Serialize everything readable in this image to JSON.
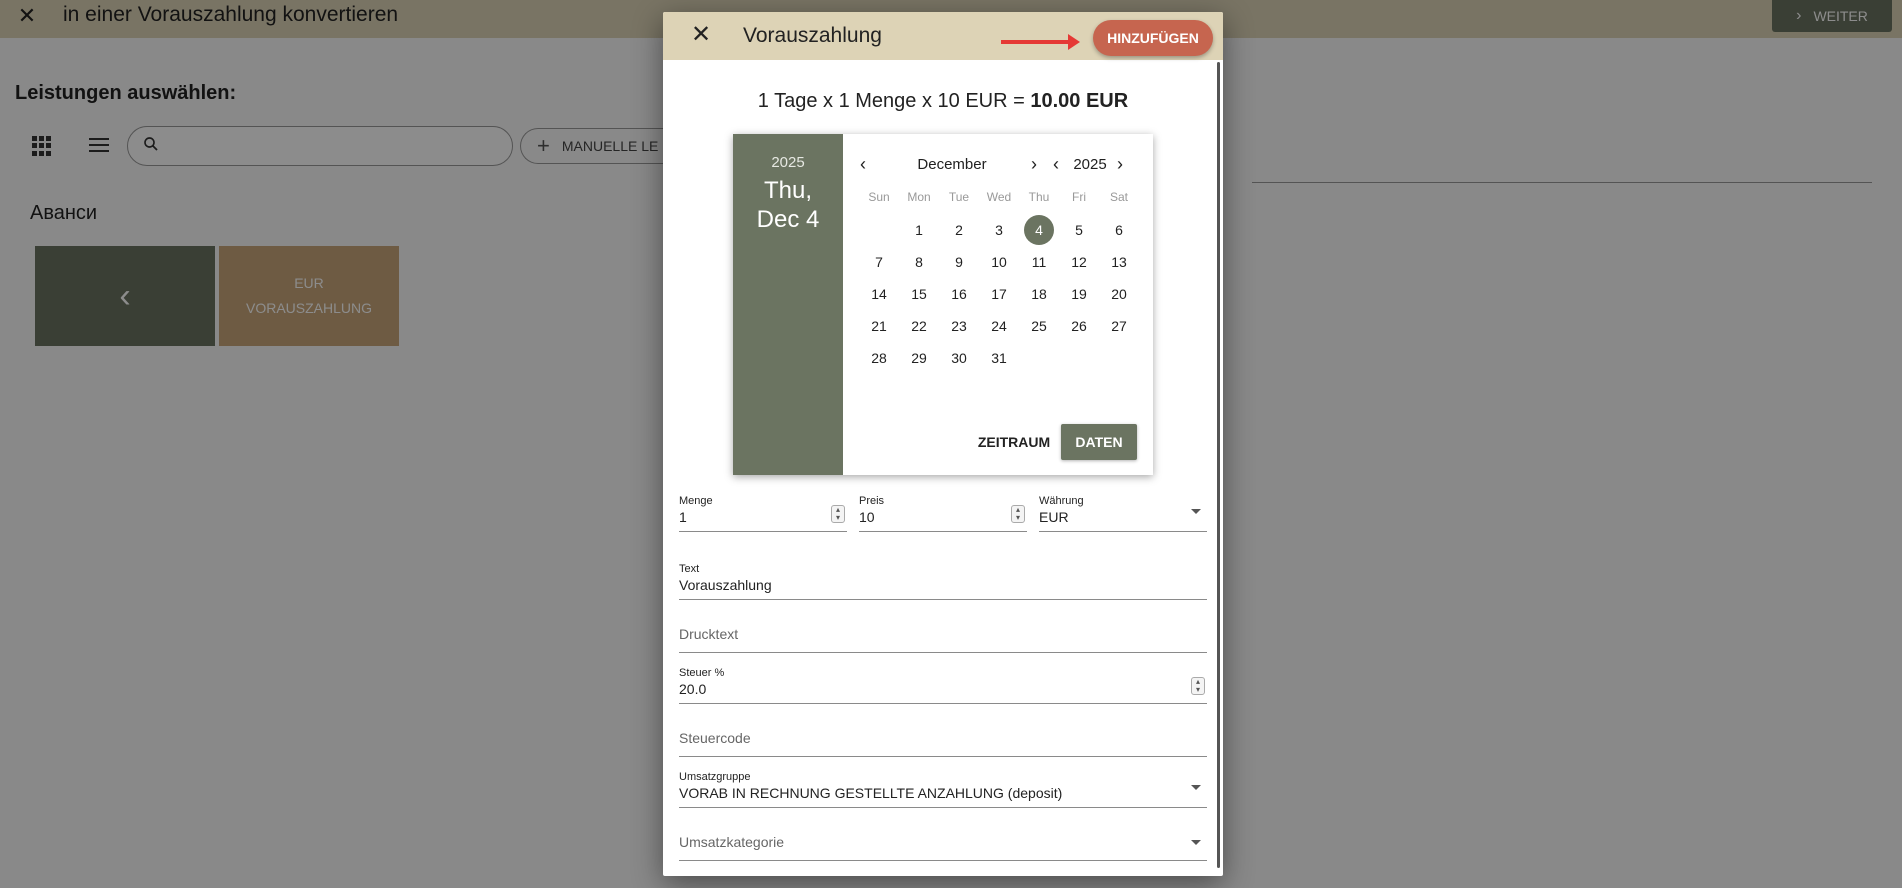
{
  "background": {
    "title": "in einer Vorauszahlung konvertieren",
    "weiter_label": "WEITER",
    "heading": "Leistungen auswählen:",
    "manual_label": "MANUELLE LE",
    "category": "Аванси",
    "tile_label_1": "EUR",
    "tile_label_2": "VORAUSZAHLUNG"
  },
  "dialog": {
    "title": "Vorauszahlung",
    "add_label": "HINZUFÜGEN",
    "summary_prefix": "1 Tage x 1 Menge x 10 EUR = ",
    "summary_total": "10.00 EUR"
  },
  "datepicker": {
    "side_year": "2025",
    "side_weekday": "Thu,",
    "side_date": "Dec 4",
    "month": "December",
    "year": "2025",
    "weekdays": [
      "Sun",
      "Mon",
      "Tue",
      "Wed",
      "Thu",
      "Fri",
      "Sat"
    ],
    "leading_blanks": 1,
    "days": [
      "1",
      "2",
      "3",
      "4",
      "5",
      "6",
      "7",
      "8",
      "9",
      "10",
      "11",
      "12",
      "13",
      "14",
      "15",
      "16",
      "17",
      "18",
      "19",
      "20",
      "21",
      "22",
      "23",
      "24",
      "25",
      "26",
      "27",
      "28",
      "29",
      "30",
      "31"
    ],
    "selected_day": "4",
    "zeitraum_label": "ZEITRAUM",
    "daten_label": "DATEN"
  },
  "form": {
    "menge": {
      "label": "Menge",
      "value": "1"
    },
    "preis": {
      "label": "Preis",
      "value": "10"
    },
    "waehrung": {
      "label": "Währung",
      "value": "EUR"
    },
    "text": {
      "label": "Text",
      "value": "Vorauszahlung"
    },
    "drucktext": {
      "placeholder": "Drucktext"
    },
    "steuer": {
      "label": "Steuer %",
      "value": "20.0"
    },
    "steuercode": {
      "placeholder": "Steuercode"
    },
    "umsatzgruppe": {
      "label": "Umsatzgruppe",
      "value": "VORAB IN RECHNUNG GESTELLTE ANZAHLUNG (deposit)"
    },
    "umsatzkategorie": {
      "placeholder": "Umsatzkategorie"
    }
  },
  "colors": {
    "header": "#ddd3b6",
    "accent_green": "#6b7461",
    "accent_red": "#c6654f",
    "arrow": "#e53935"
  }
}
